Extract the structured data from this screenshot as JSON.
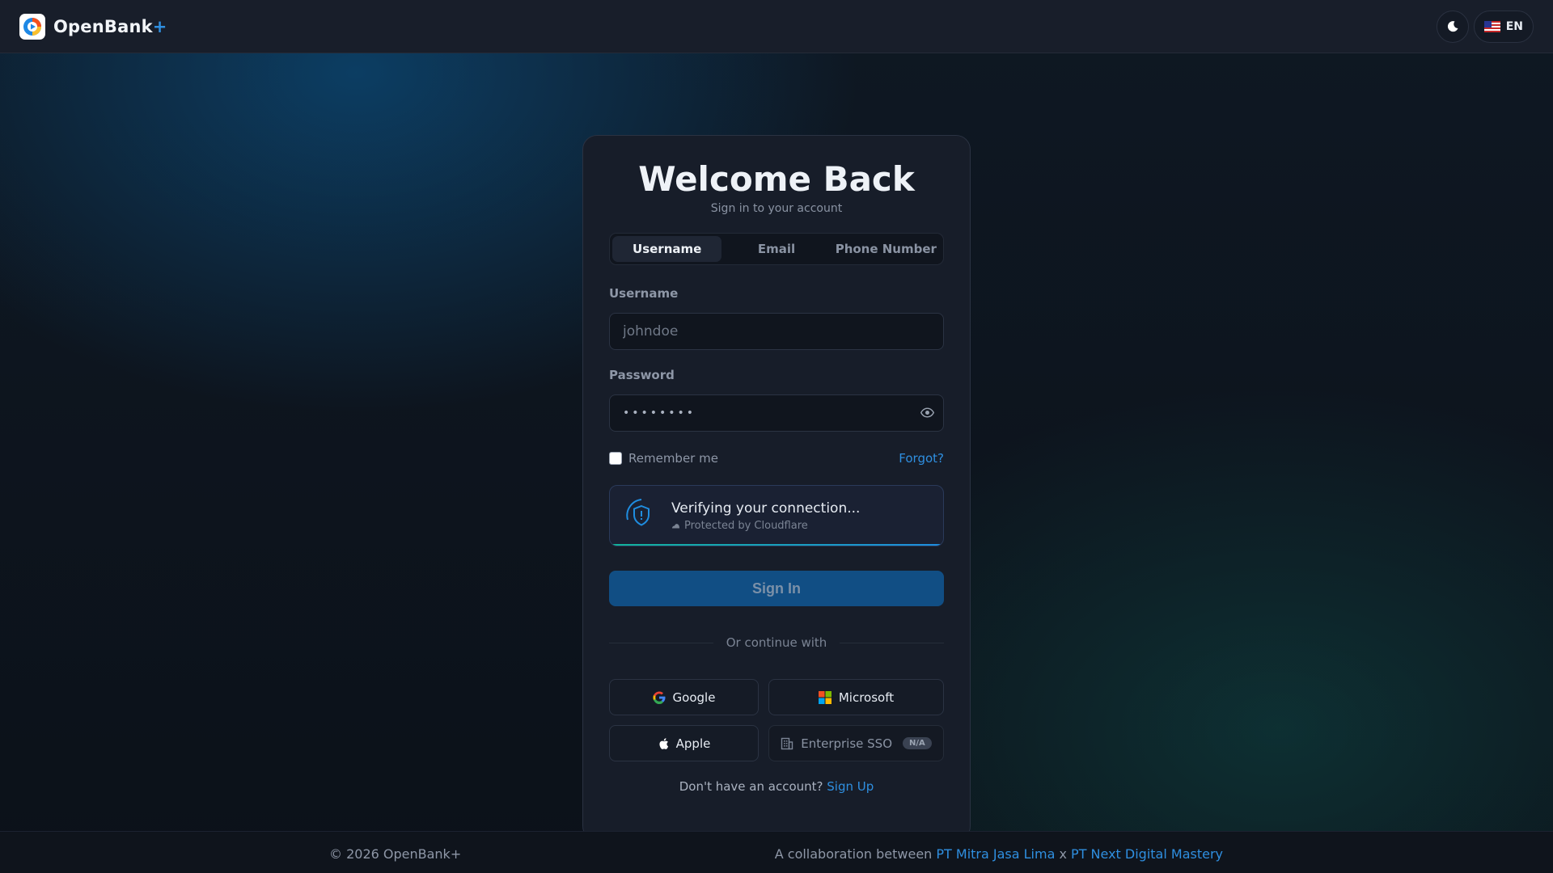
{
  "header": {
    "brand_name": "OpenBank",
    "brand_plus": "+",
    "language_code": "EN",
    "theme_icon": "moon-icon",
    "flag_icon": "us-flag-icon"
  },
  "card": {
    "title": "Welcome Back",
    "subtitle": "Sign in to your account",
    "tabs": [
      {
        "label": "Username",
        "active": true
      },
      {
        "label": "Email",
        "active": false
      },
      {
        "label": "Phone Number",
        "active": false
      }
    ],
    "username": {
      "label": "Username",
      "placeholder": "johndoe",
      "value": ""
    },
    "password": {
      "label": "Password",
      "masked_value": "••••••••",
      "toggle_icon": "eye-icon"
    },
    "remember_label": "Remember me",
    "remember_checked": false,
    "forgot_label": "Forgot?",
    "verification": {
      "title": "Verifying your connection...",
      "subtitle": "Protected by Cloudflare",
      "icon": "shield-alert-icon"
    },
    "signin_label": "Sign In",
    "divider_text": "Or continue with",
    "social": {
      "google": "Google",
      "microsoft": "Microsoft",
      "apple": "Apple",
      "enterprise": "Enterprise SSO",
      "enterprise_badge": "N/A"
    },
    "signup_prompt": "Don't have an account?",
    "signup_link": "Sign Up"
  },
  "footer": {
    "copyright": "© 2026 OpenBank+",
    "collab_prefix": "A collaboration between",
    "company_a": "PT Mitra Jasa Lima",
    "separator": "x",
    "company_b": "PT Next Digital Mastery"
  },
  "colors": {
    "accent": "#2f8fe0",
    "signin_button": "#114e84",
    "card_background": "#171d29",
    "verify_bar_start": "#12b39a",
    "verify_bar_end": "#1f8de0"
  }
}
